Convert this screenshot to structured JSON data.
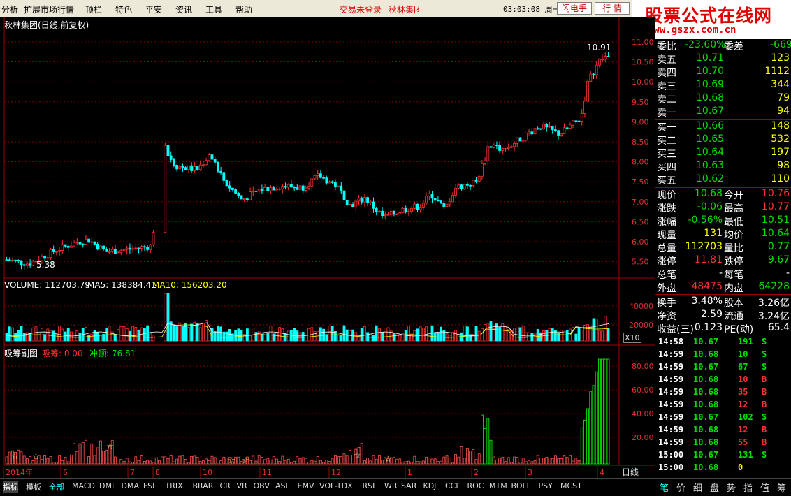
{
  "menu": {
    "items": [
      "分析",
      "扩展市场行情",
      "顶栏",
      "特色",
      "平安",
      "资讯",
      "工具",
      "帮助"
    ],
    "login_status": "交易未登录",
    "brand_name": "秋林集团",
    "clock": "03:03:08 周一",
    "flash_button": "闪电手",
    "quote_button": "行 情"
  },
  "logo": {
    "title": "股票公式在线网",
    "url": "www.gszx.com.cn"
  },
  "chart": {
    "title": "秋林集团(日线,前复权)",
    "high_label": "10.91",
    "low_label": "5.38",
    "price_ticks": [
      "11.00",
      "10.50",
      "10.00",
      "9.50",
      "9.00",
      "8.50",
      "8.00",
      "7.50",
      "7.00",
      "6.50",
      "6.00",
      "5.50"
    ],
    "volume_header": {
      "volume": "VOLUME: 112703.79",
      "ma5": "MA5: 138384.41",
      "ma10": "MA10: 156203.20"
    },
    "volume_ticks": [
      "40000",
      "20000"
    ],
    "volume_unit": "X10",
    "sub_header": {
      "name": "吸筹副图",
      "absorb": "吸筹: 0.00",
      "peak": "冲顶: 76.81"
    },
    "sub_ticks": [
      "80.00",
      "60.00",
      "40.00",
      "20.00"
    ],
    "date_labels": [
      "2014年",
      "6",
      "7",
      "8",
      "9",
      "10",
      "11",
      "12",
      "1",
      "2",
      "3",
      "4"
    ],
    "day_button": "日线"
  },
  "quote": {
    "weibi": {
      "label": "委比",
      "value": "-23.60%",
      "label2": "委差",
      "value2": "-669"
    },
    "sells": [
      {
        "label": "卖五",
        "price": "10.71",
        "vol": "123"
      },
      {
        "label": "卖四",
        "price": "10.70",
        "vol": "1112"
      },
      {
        "label": "卖三",
        "price": "10.69",
        "vol": "344"
      },
      {
        "label": "卖二",
        "price": "10.68",
        "vol": "79"
      },
      {
        "label": "卖一",
        "price": "10.67",
        "vol": "94"
      }
    ],
    "buys": [
      {
        "label": "买一",
        "price": "10.66",
        "vol": "148"
      },
      {
        "label": "买二",
        "price": "10.65",
        "vol": "532"
      },
      {
        "label": "买三",
        "price": "10.64",
        "vol": "197"
      },
      {
        "label": "买四",
        "price": "10.63",
        "vol": "98"
      },
      {
        "label": "买五",
        "price": "10.62",
        "vol": "110"
      }
    ],
    "stats": [
      {
        "l1": "现价",
        "v1": "10.68",
        "c1": "#00e000",
        "l2": "今开",
        "v2": "10.76",
        "c2": "#ff3030"
      },
      {
        "l1": "涨跌",
        "v1": "-0.06",
        "c1": "#00e000",
        "l2": "最高",
        "v2": "10.77",
        "c2": "#ff3030"
      },
      {
        "l1": "涨幅",
        "v1": "-0.56%",
        "c1": "#00e000",
        "l2": "最低",
        "v2": "10.51",
        "c2": "#00e000"
      },
      {
        "l1": "现量",
        "v1": "131",
        "c1": "#ffff00",
        "l2": "均价",
        "v2": "10.64",
        "c2": "#00e000"
      },
      {
        "l1": "总量",
        "v1": "112703",
        "c1": "#ffff00",
        "l2": "量比",
        "v2": "0.77",
        "c2": "#00e000"
      },
      {
        "l1": "涨停",
        "v1": "11.81",
        "c1": "#ff3030",
        "l2": "跌停",
        "v2": "9.67",
        "c2": "#00e000"
      },
      {
        "l1": "总笔",
        "v1": "-",
        "c1": "#ffffff",
        "l2": "每笔",
        "v2": "-",
        "c2": "#ffffff"
      },
      {
        "l1": "外盘",
        "v1": "48475",
        "c1": "#ff3030",
        "l2": "内盘",
        "v2": "64228",
        "c2": "#00e000"
      }
    ],
    "fundamentals": [
      {
        "l1": "换手",
        "v1": "3.48%",
        "l2": "股本",
        "v2": "3.26亿"
      },
      {
        "l1": "净资",
        "v1": "2.59",
        "l2": "流通",
        "v2": "3.24亿"
      },
      {
        "l1": "收益(三)",
        "v1": "0.123",
        "l2": "PE(动)",
        "v2": "65.4"
      }
    ]
  },
  "trades": [
    {
      "time": "14:58",
      "price": "10.67",
      "vol": "191",
      "side": "S"
    },
    {
      "time": "14:59",
      "price": "10.68",
      "vol": "10",
      "side": "S"
    },
    {
      "time": "14:59",
      "price": "10.67",
      "vol": "67",
      "side": "S"
    },
    {
      "time": "14:59",
      "price": "10.68",
      "vol": "10",
      "side": "B"
    },
    {
      "time": "14:59",
      "price": "10.68",
      "vol": "35",
      "side": "B"
    },
    {
      "time": "14:59",
      "price": "10.68",
      "vol": "12",
      "side": "B"
    },
    {
      "time": "14:59",
      "price": "10.67",
      "vol": "102",
      "side": "S"
    },
    {
      "time": "14:59",
      "price": "10.68",
      "vol": "12",
      "side": "B"
    },
    {
      "time": "14:59",
      "price": "10.68",
      "vol": "55",
      "side": "B"
    },
    {
      "time": "15:00",
      "price": "10.67",
      "vol": "131",
      "side": "S"
    },
    {
      "time": "15:00",
      "price": "10.68",
      "vol": "0",
      "side": ""
    }
  ],
  "bottom_tabs": [
    "指标",
    "模板",
    "全部",
    "MACD",
    "DMI",
    "DMA",
    "FSL",
    "TRIX",
    "BRAR",
    "CR",
    "VR",
    "OBV",
    "ASI",
    "EMV",
    "VOL-TDX",
    "RSI",
    "WR",
    "SAR",
    "KDJ",
    "CCI",
    "ROC",
    "MTM",
    "BOLL",
    "PSY",
    "MCST"
  ],
  "right_tabs": [
    "笔",
    "价",
    "细",
    "盘",
    "势",
    "指",
    "值",
    "筹"
  ],
  "colors": {
    "up": "#ff3030",
    "down": "#00ffff",
    "green": "#00e000",
    "yellow": "#ffff00",
    "grid": "#7a0000"
  }
}
